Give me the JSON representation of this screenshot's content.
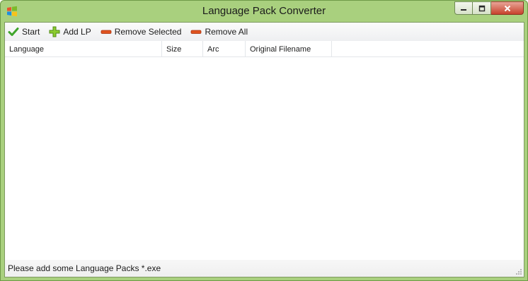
{
  "window": {
    "title": "Language Pack Converter"
  },
  "toolbar": {
    "start_label": "Start",
    "add_label": "Add LP",
    "remove_selected_label": "Remove Selected",
    "remove_all_label": "Remove All"
  },
  "list": {
    "columns": [
      "Language",
      "Size",
      "Arc",
      "Original Filename"
    ],
    "rows": []
  },
  "status": {
    "text": "Please add some Language Packs *.exe"
  },
  "icons": {
    "app": "windows-logo-icon",
    "start": "checkmark-icon",
    "add": "plus-icon",
    "remove_selected": "minus-icon",
    "remove_all": "minus-icon"
  },
  "colors": {
    "frame": "#a9d07e",
    "check": "#3fa52b",
    "plus": "#8ccc2f",
    "minus": "#e0531f"
  }
}
